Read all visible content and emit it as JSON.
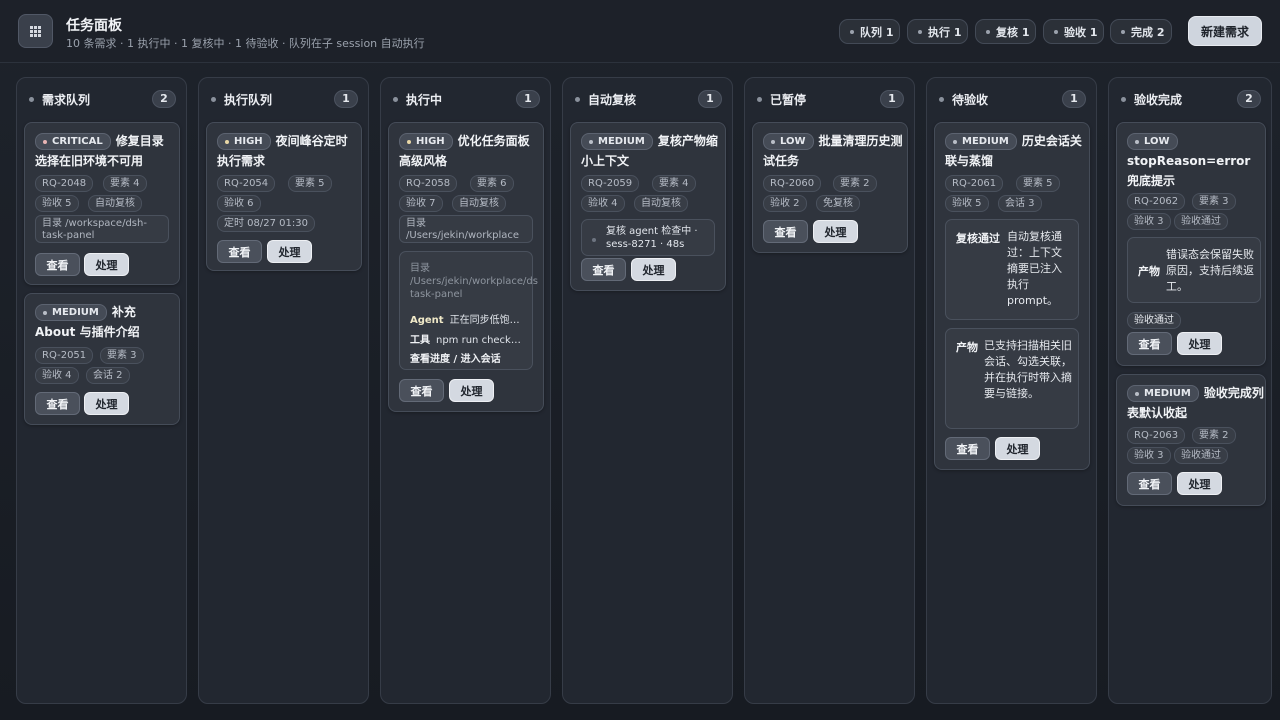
{
  "header": {
    "title": "任务面板",
    "subtitle": "10 条需求 · 1 执行中 · 1 复核中 · 1 待验收 · 队列在子 session 自动执行",
    "stats": [
      "队列 1",
      "执行 1",
      "复核 1",
      "验收 1",
      "完成 2"
    ],
    "new_button": "新建需求"
  },
  "actions": {
    "view": "查看",
    "act": "处理"
  },
  "columns": [
    {
      "title": "需求队列",
      "count": "2"
    },
    {
      "title": "执行队列",
      "count": "1"
    },
    {
      "title": "执行中",
      "count": "1"
    },
    {
      "title": "自动复核",
      "count": "1"
    },
    {
      "title": "已暂停",
      "count": "1"
    },
    {
      "title": "待验收",
      "count": "1"
    },
    {
      "title": "验收完成",
      "count": "2"
    }
  ],
  "cards": {
    "c1": {
      "priority": "CRITICAL",
      "title": "修复目录选择在旧环境不可用",
      "id": "RQ-2048",
      "elements": "要素 4",
      "accept": "验收 5",
      "review": "自动复核",
      "path": "目录 /workspace/dsh-\ntask-panel"
    },
    "c2": {
      "priority": "MEDIUM",
      "title": "补充 About 与插件介绍",
      "id": "RQ-2051",
      "elements": "要素 3",
      "accept": "验收 4",
      "sessions": "会话 2"
    },
    "c3": {
      "priority": "HIGH",
      "title": "夜间峰谷定时执行需求",
      "id": "RQ-2054",
      "elements": "要素 5",
      "accept": "验收 6",
      "schedule": "定时 08/27 01:30"
    },
    "c4": {
      "priority": "HIGH",
      "title": "优化任务面板高级风格",
      "id": "RQ-2058",
      "elements": "要素 6",
      "accept": "验收 7",
      "review": "自动复核",
      "path": "目录\n/Users/jekin/workplace",
      "agent_path": "目录\n/Users/jekin/workplace/ds\ntask-panel",
      "agent_label": "Agent",
      "agent_value": "正在同步低饱…",
      "tool_label": "工具",
      "tool_value": "npm run check…",
      "link": "查看进度 / 进入会话"
    },
    "c5": {
      "priority": "MEDIUM",
      "title": "复核产物缩小上下文",
      "id": "RQ-2059",
      "elements": "要素 4",
      "accept": "验收 4",
      "review": "自动复核",
      "status": "复核 agent 检查中 ·\nsess-8271 · 48s"
    },
    "c6": {
      "priority": "LOW",
      "title": "批量清理历史测试任务",
      "id": "RQ-2060",
      "elements": "要素 2",
      "accept": "验收 2",
      "review": "免复核"
    },
    "c7": {
      "priority": "MEDIUM",
      "title": "历史会话关联与蒸馏",
      "id": "RQ-2061",
      "elements": "要素 5",
      "accept": "验收 5",
      "sessions": "会话 3",
      "kv1_key": "复核通过",
      "kv1_value": "自动复核通过：上下文摘要已注入执行 prompt。",
      "kv2_key": "产物",
      "kv2_value": "已支持扫描相关旧会话、勾选关联，并在执行时带入摘要与链接。"
    },
    "c8": {
      "priority": "LOW",
      "title": "stopReason=error 兜底提示",
      "id": "RQ-2062",
      "elements": "要素 3",
      "accept": "验收 3",
      "passed": "验收通过",
      "kv_key": "产物",
      "kv_value": "错误态会保留失败原因，支持后续返工。",
      "badge": "验收通过"
    },
    "c9": {
      "priority": "MEDIUM",
      "title": "验收完成列表默认收起",
      "id": "RQ-2063",
      "elements": "要素 2",
      "accept": "验收 3",
      "passed": "验收通过"
    }
  },
  "icons": {
    "logo": "grid-icon"
  }
}
